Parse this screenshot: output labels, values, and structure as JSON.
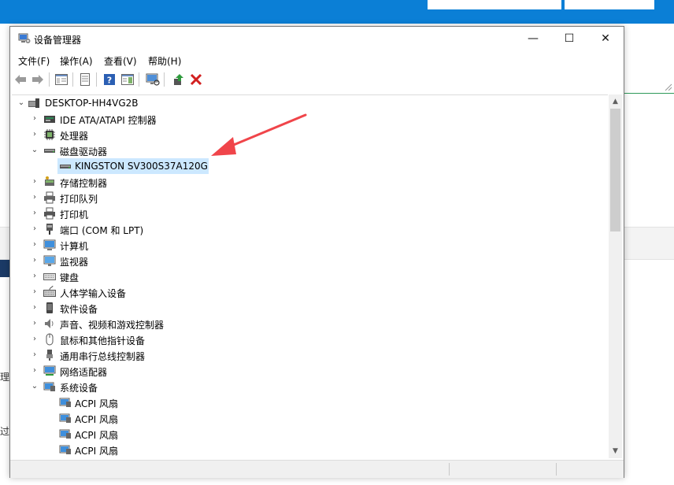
{
  "window": {
    "title": "设备管理器",
    "controls": {
      "minimize": "—",
      "maximize": "☐",
      "close": "✕"
    }
  },
  "menu": [
    "文件(F)",
    "操作(A)",
    "查看(V)",
    "帮助(H)"
  ],
  "toolbar": {
    "icons": [
      "back-arrow-icon",
      "forward-arrow-icon",
      "show-hide-tree-icon",
      "properties-icon",
      "help-icon",
      "details-pane-icon",
      "scan-hardware-icon",
      "update-driver-icon",
      "uninstall-icon"
    ]
  },
  "tree": {
    "root": "DESKTOP-HH4VG2B",
    "nodes": [
      {
        "label": "IDE ATA/ATAPI 控制器",
        "expanded": false,
        "icon": "ide-controller-icon"
      },
      {
        "label": "处理器",
        "expanded": false,
        "icon": "processor-icon"
      },
      {
        "label": "磁盘驱动器",
        "expanded": true,
        "icon": "disk-drive-icon"
      },
      {
        "label": "KINGSTON SV300S37A120G",
        "child": true,
        "icon": "disk-drive-icon",
        "selected": true
      },
      {
        "label": "存储控制器",
        "expanded": false,
        "icon": "storage-controller-icon"
      },
      {
        "label": "打印队列",
        "expanded": false,
        "icon": "print-queue-icon"
      },
      {
        "label": "打印机",
        "expanded": false,
        "icon": "printer-icon"
      },
      {
        "label": "端口 (COM 和 LPT)",
        "expanded": false,
        "icon": "port-icon"
      },
      {
        "label": "计算机",
        "expanded": false,
        "icon": "computer-icon"
      },
      {
        "label": "监视器",
        "expanded": false,
        "icon": "monitor-icon"
      },
      {
        "label": "键盘",
        "expanded": false,
        "icon": "keyboard-icon"
      },
      {
        "label": "人体学输入设备",
        "expanded": false,
        "icon": "hid-icon"
      },
      {
        "label": "软件设备",
        "expanded": false,
        "icon": "software-device-icon"
      },
      {
        "label": "声音、视频和游戏控制器",
        "expanded": false,
        "icon": "sound-icon"
      },
      {
        "label": "鼠标和其他指针设备",
        "expanded": false,
        "icon": "mouse-icon"
      },
      {
        "label": "通用串行总线控制器",
        "expanded": false,
        "icon": "usb-icon"
      },
      {
        "label": "网络适配器",
        "expanded": false,
        "icon": "network-adapter-icon"
      },
      {
        "label": "系统设备",
        "expanded": true,
        "icon": "system-device-icon"
      },
      {
        "label": "ACPI 风扇",
        "child": true,
        "icon": "system-device-icon"
      },
      {
        "label": "ACPI 风扇",
        "child": true,
        "icon": "system-device-icon"
      },
      {
        "label": "ACPI 风扇",
        "child": true,
        "icon": "system-device-icon"
      },
      {
        "label": "ACPI 风扇",
        "child": true,
        "icon": "system-device-icon"
      }
    ]
  },
  "background": {
    "fragment_1": "理",
    "fragment_2": "过"
  },
  "colors": {
    "accent_blue": "#0b7fd6",
    "selection": "#cce8ff",
    "annotation_arrow": "#f0454a"
  }
}
